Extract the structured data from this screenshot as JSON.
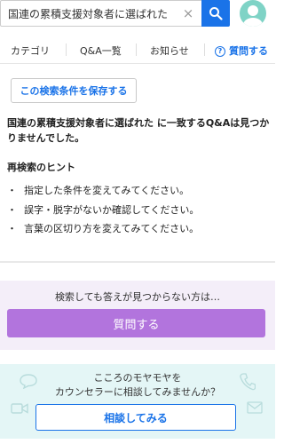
{
  "search": {
    "value": "国連の累積支援対象者に選ばれた",
    "clear_glyph": "×",
    "button_icon": "search-icon"
  },
  "avatar_icon": "avatar-icon",
  "nav": {
    "items": [
      {
        "label": "カテゴリ"
      },
      {
        "label": "Q&A一覧"
      },
      {
        "label": "お知らせ"
      }
    ],
    "ask_label": "質問する",
    "ask_icon_glyph": "?"
  },
  "save_button_label": "この検索条件を保存する",
  "result_message": "国連の累積支援対象者に選ばれた に一致するQ&Aは見つかりませんでした。",
  "hints": {
    "title": "再検索のヒント",
    "bullet": "・",
    "items": [
      "指定した条件を変えてみてください。",
      "誤字・脱字がないか確認してください。",
      "言葉の区切り方を変えてみてください。"
    ]
  },
  "ask_box": {
    "message": "検索しても答えが見つからない方は…",
    "button_label": "質問する"
  },
  "counsel_box": {
    "line1": "こころのモヤモヤを",
    "line2": "カウンセラーに相談してみませんか？",
    "button_label": "相談してみる"
  },
  "colors": {
    "primary_blue": "#1a73e8",
    "ask_purple": "#b274dd",
    "ask_bg": "#f4eef9",
    "counsel_bg": "#e4f6f6",
    "avatar": "#7fd3c6"
  }
}
